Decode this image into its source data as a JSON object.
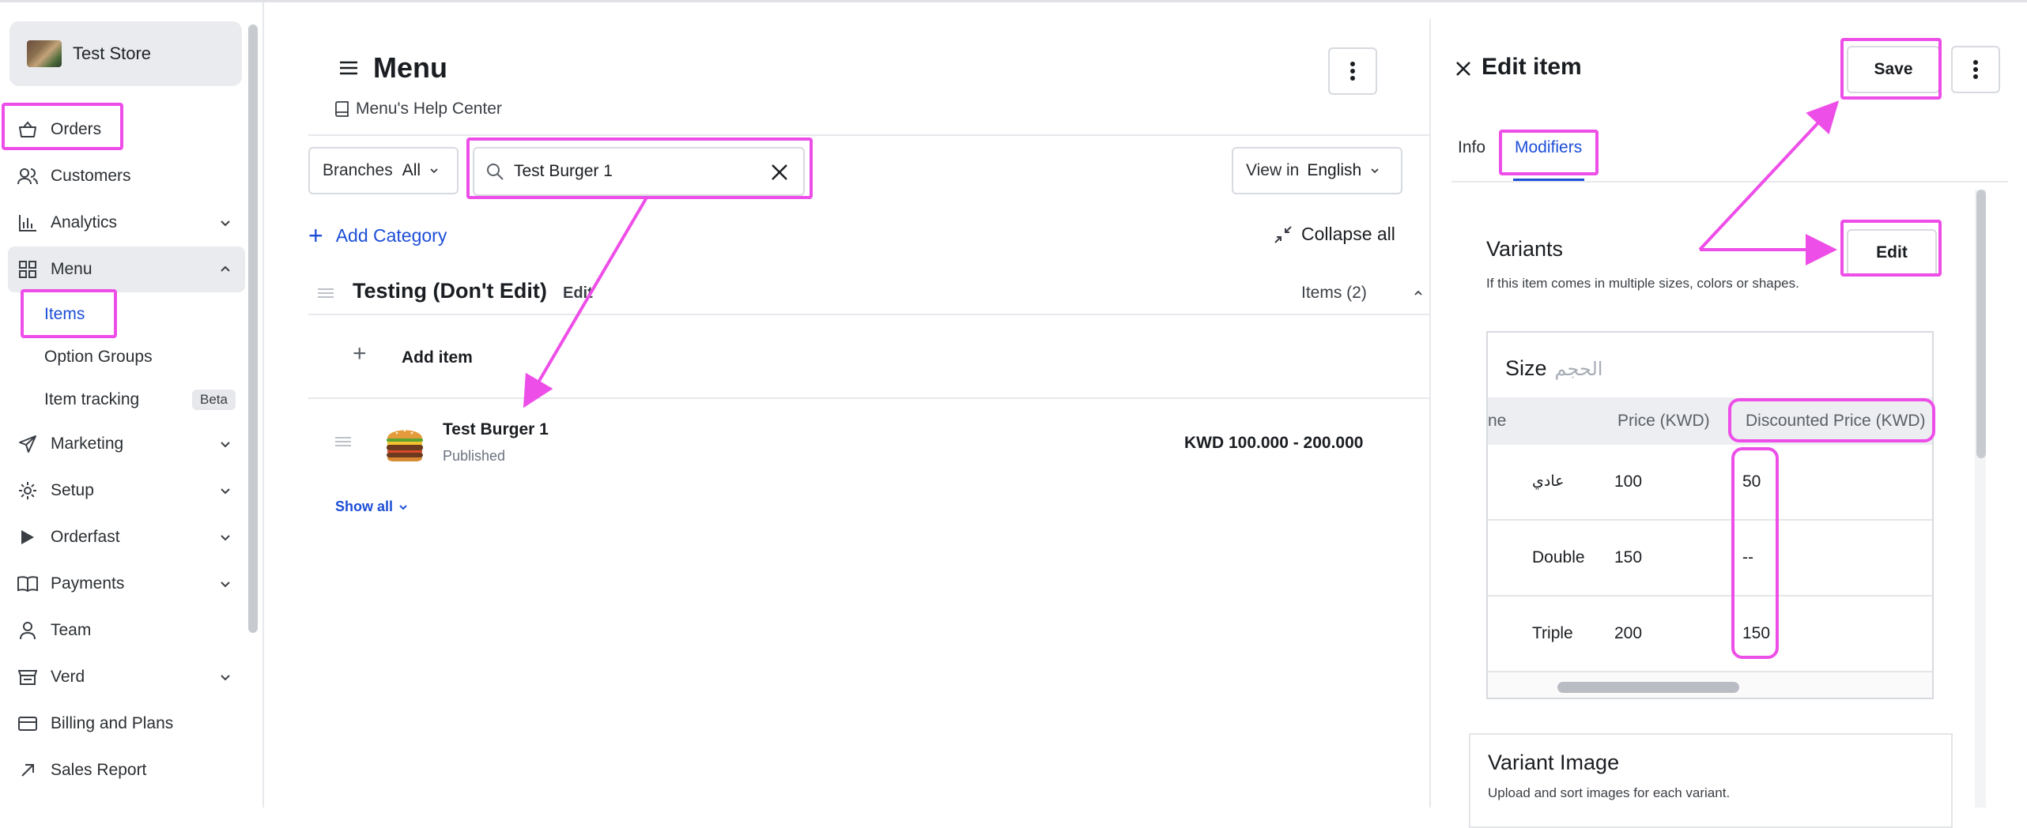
{
  "sidebar": {
    "store_name": "Test Store",
    "items": [
      {
        "label": "Orders",
        "icon": "shopping-basket-icon"
      },
      {
        "label": "Customers",
        "icon": "users-icon"
      },
      {
        "label": "Analytics",
        "icon": "bar-chart-icon"
      },
      {
        "label": "Menu",
        "icon": "grid-icon"
      },
      {
        "label": "Marketing",
        "icon": "send-icon"
      },
      {
        "label": "Setup",
        "icon": "gear-icon"
      },
      {
        "label": "Orderfast",
        "icon": "play-icon"
      },
      {
        "label": "Payments",
        "icon": "book-icon"
      },
      {
        "label": "Team",
        "icon": "user-icon"
      },
      {
        "label": "Verd",
        "icon": "register-icon"
      },
      {
        "label": "Billing and Plans",
        "icon": "card-icon"
      },
      {
        "label": "Sales Report",
        "icon": "arrow-up-right-icon"
      }
    ],
    "menu_sub": [
      {
        "label": "Items"
      },
      {
        "label": "Option Groups"
      },
      {
        "label": "Item tracking",
        "badge": "Beta"
      }
    ]
  },
  "main": {
    "title": "Menu",
    "help_link": "Menu's Help Center",
    "branches_label": "Branches",
    "branches_value": "All",
    "search_value": "Test Burger 1",
    "view_in_label": "View in",
    "view_in_value": "English",
    "add_category": "Add Category",
    "collapse_all": "Collapse all",
    "category": {
      "title": "Testing (Don't Edit)",
      "edit": "Edit",
      "count": "Items (2)"
    },
    "add_item": "Add item",
    "item": {
      "name": "Test Burger 1",
      "status": "Published",
      "price": "KWD 100.000 - 200.000"
    },
    "show_all": "Show all"
  },
  "panel": {
    "title": "Edit item",
    "save": "Save",
    "tabs": [
      "Info",
      "Modifiers"
    ],
    "active_tab": "Modifiers",
    "variants_title": "Variants",
    "variants_sub": "If this item comes in multiple sizes, colors or shapes.",
    "variants_edit": "Edit",
    "size_title": "Size",
    "size_title_ar": "الحجم",
    "columns": [
      "ne",
      "Price (KWD)",
      "Discounted Price (KWD)"
    ],
    "rows": [
      {
        "name": "عادي",
        "price": "100",
        "discounted": "50"
      },
      {
        "name": "Double",
        "price": "150",
        "discounted": "--"
      },
      {
        "name": "Triple",
        "price": "200",
        "discounted": "150"
      }
    ],
    "variant_image_title": "Variant Image",
    "variant_image_sub": "Upload and sort images for each variant."
  },
  "colors": {
    "accent": "#1d4ed8",
    "annotation": "#ee4ee8"
  }
}
